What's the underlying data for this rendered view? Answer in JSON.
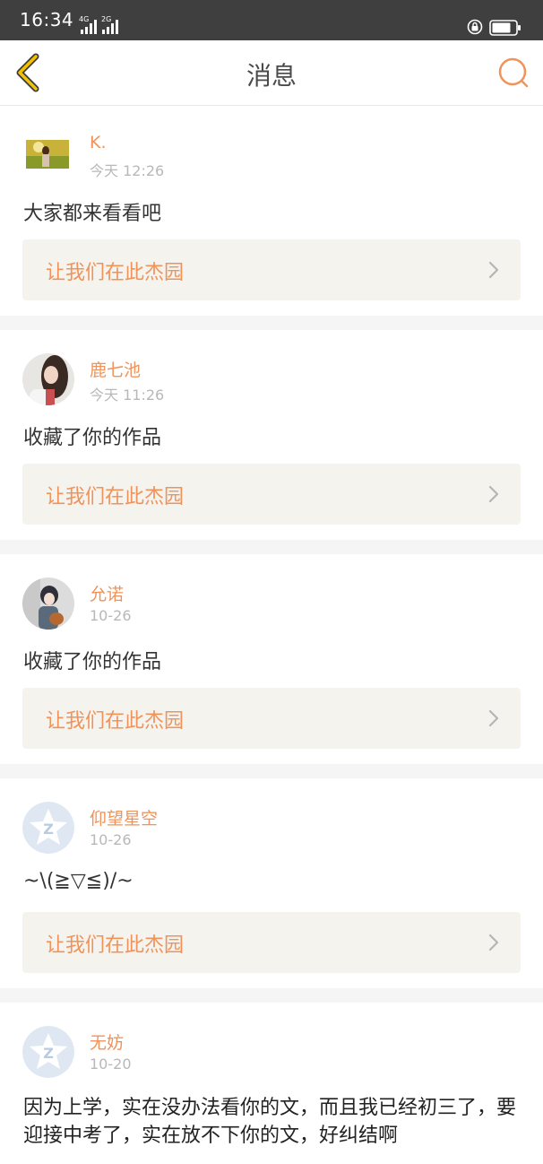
{
  "status": {
    "time": "16:34",
    "net1": "4G",
    "net2": "2G"
  },
  "header": {
    "title": "消息"
  },
  "messages": [
    {
      "name": "K.",
      "time": "今天 12:26",
      "content": "大家都来看看吧",
      "link": "让我们在此杰园"
    },
    {
      "name": "鹿七池",
      "time": "今天 11:26",
      "content": "收藏了你的作品",
      "link": "让我们在此杰园"
    },
    {
      "name": "允诺",
      "time": "10-26",
      "content": "收藏了你的作品",
      "link": "让我们在此杰园"
    },
    {
      "name": "仰望星空",
      "time": "10-26",
      "content": "~\\(≧▽≦)/~",
      "link": "让我们在此杰园"
    },
    {
      "name": "无妨",
      "time": "10-20",
      "content": "因为上学，实在没办法看你的文，而且我已经初三了，要迎接中考了，实在放不下你的文，好纠结啊"
    }
  ],
  "colors": {
    "accent": "#f0935a",
    "back_arrow": "#e8b700",
    "statusbar": "#3f3f3f"
  }
}
